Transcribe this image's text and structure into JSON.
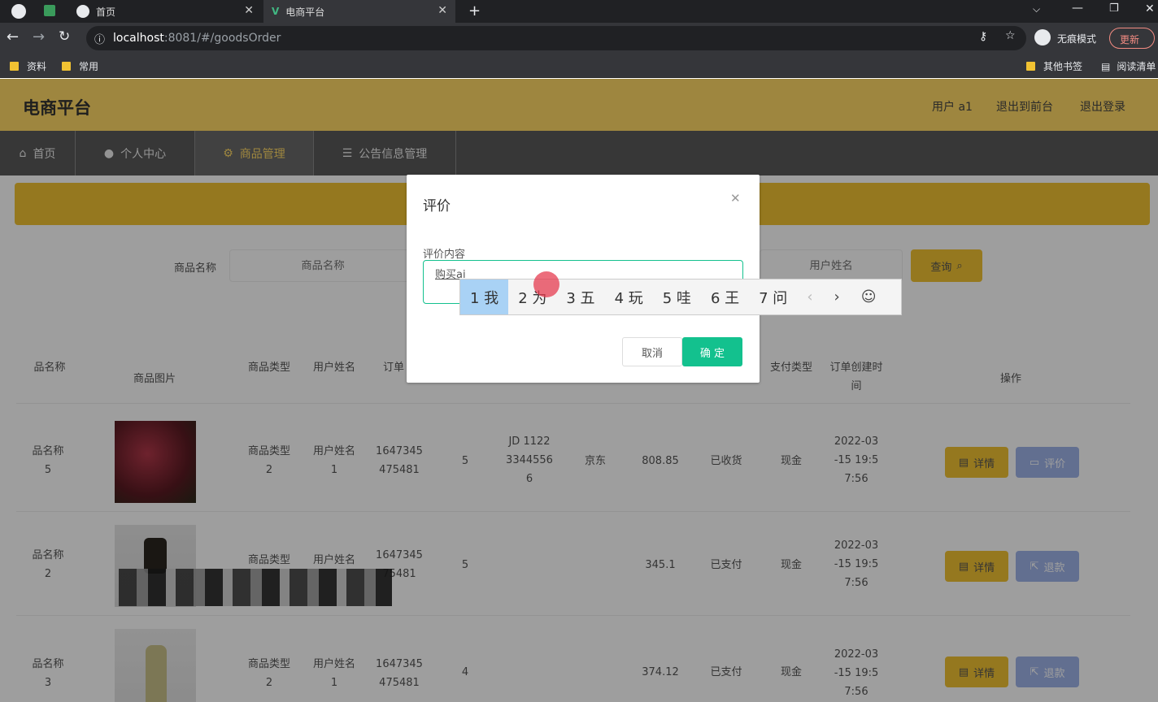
{
  "browser": {
    "tabs": [
      {
        "title": "首页"
      },
      {
        "title": "电商平台"
      }
    ],
    "url_host": "localhost",
    "url_rest": ":8081/#/goodsOrder",
    "incognito_label": "无痕模式",
    "update_label": "更新",
    "bookmarks": [
      "资料",
      "常用"
    ],
    "bookmarks_right": [
      "其他书签",
      "阅读清单"
    ]
  },
  "header": {
    "title": "电商平台",
    "user": "用户 a1",
    "back_front": "退出到前台",
    "logout": "退出登录"
  },
  "nav": [
    "首页",
    "个人中心",
    "商品管理",
    "公告信息管理"
  ],
  "search": {
    "goods_name_label": "商品名称",
    "goods_name_placeholder": "商品名称",
    "user_name_placeholder": "用户姓名",
    "query_button": "查询"
  },
  "table": {
    "headers": [
      "品名称",
      "商品图片",
      "商品类型",
      "用户姓名",
      "订单",
      "支付类型",
      "订单创建时间",
      "操作"
    ],
    "rows": [
      {
        "name": "品名称 5",
        "type": "商品类型 2",
        "user": "用户姓名 1",
        "order": "1647345 475481",
        "qty": "5",
        "express": "JD 1122 3344556 6",
        "company": "京东",
        "total": "808.85",
        "status": "已收货",
        "pay": "现金",
        "time": "2022-03 -15 19:5 7:56",
        "btn1": "详情",
        "btn2": "评价"
      },
      {
        "name": "品名称 2",
        "type": "商品类型",
        "user": "用户姓名",
        "order": "1647345 75481",
        "qty": "5",
        "express": "",
        "company": "",
        "total": "345.1",
        "status": "已支付",
        "pay": "现金",
        "time": "2022-03 -15 19:5 7:56",
        "btn1": "详情",
        "btn2": "退款"
      },
      {
        "name": "品名称 3",
        "type": "商品类型 2",
        "user": "用户姓名 1",
        "order": "1647345 475481",
        "qty": "4",
        "express": "",
        "company": "",
        "total": "374.12",
        "status": "已支付",
        "pay": "现金",
        "time": "2022-03 -15 19:5 7:56",
        "btn1": "详情",
        "btn2": "退款"
      }
    ]
  },
  "dialog": {
    "title": "评价",
    "field_label": "评价内容",
    "field_value": "购买ai",
    "cancel": "取消",
    "confirm": "确 定"
  },
  "ime": {
    "candidates": [
      "1 我",
      "2 为",
      "3 五",
      "4 玩",
      "5 哇",
      "6 王",
      "7 问"
    ]
  },
  "colors": {
    "accent": "#ffd966",
    "confirm": "#13c18e"
  }
}
